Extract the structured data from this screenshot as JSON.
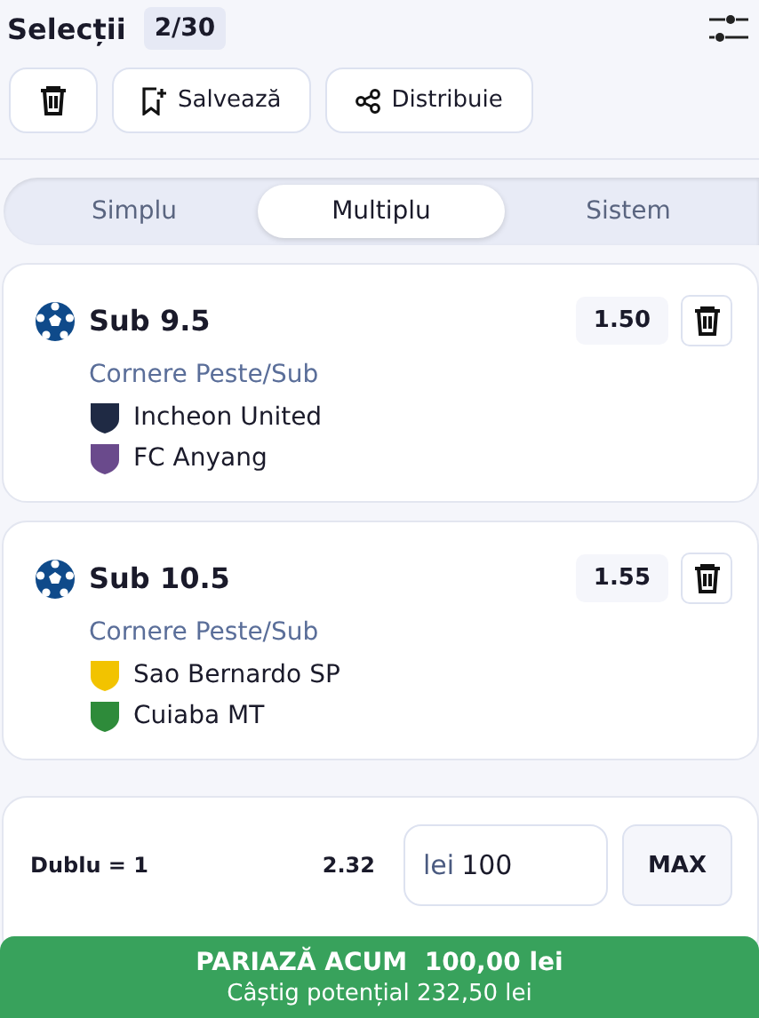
{
  "header": {
    "title": "Selecții",
    "count": "2/30"
  },
  "actions": [
    {
      "kind": "delete"
    },
    {
      "kind": "save",
      "label": "Salvează"
    },
    {
      "kind": "share",
      "label": "Distribuie"
    }
  ],
  "tabs": [
    {
      "label": "Simplu",
      "selected": false
    },
    {
      "label": "Multiplu",
      "selected": true
    },
    {
      "label": "Sistem",
      "selected": false
    }
  ],
  "selections": [
    {
      "pick": "Sub 9.5",
      "odds": "1.50",
      "market": "Cornere Peste/Sub",
      "teams": [
        {
          "name": "Incheon United",
          "color": "#1f2a44"
        },
        {
          "name": "FC Anyang",
          "color": "#6a4a8c"
        }
      ]
    },
    {
      "pick": "Sub 10.5",
      "odds": "1.55",
      "market": "Cornere Peste/Sub",
      "teams": [
        {
          "name": "Sao Bernardo SP",
          "color": "#f2c300"
        },
        {
          "name": "Cuiaba MT",
          "color": "#2e8b3a"
        }
      ]
    }
  ],
  "stake": {
    "label": "Dublu = 1",
    "odds": "2.32",
    "currency": "lei",
    "value": "100",
    "max": "MAX"
  },
  "place_bet": {
    "label": "PARIAZĂ ACUM  100,00 lei",
    "potential": "Câștig potențial 232,50 lei"
  }
}
